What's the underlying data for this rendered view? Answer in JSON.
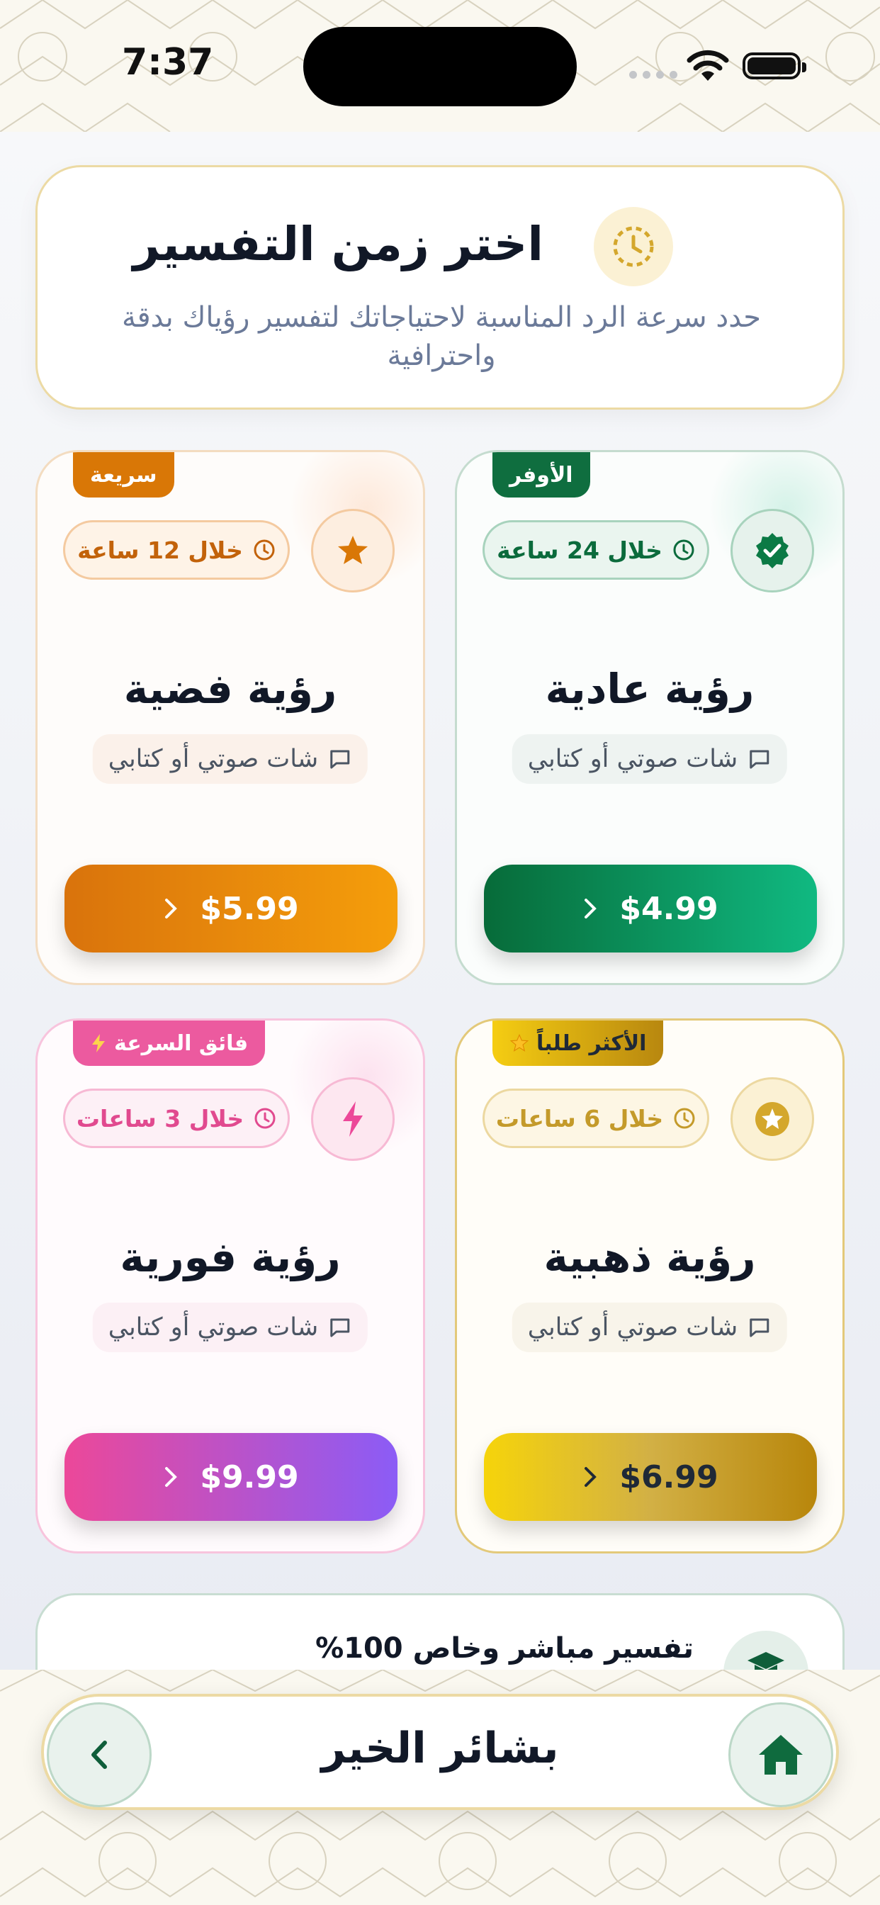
{
  "status_bar": {
    "time": "7:37"
  },
  "header": {
    "title": "اختر زمن التفسير",
    "subtitle": "حدد سرعة الرد المناسبة لاحتياجاتك لتفسير رؤياك بدقة واحترافية",
    "icon": "clock-icon"
  },
  "plans": [
    {
      "badge": "الأوفر",
      "time": "خلال 24 ساعة",
      "name": "رؤية عادية",
      "channel": "شات صوتي أو كتابي",
      "price": "$4.99",
      "icon": "verified-badge-icon",
      "accent": "#0b7a45"
    },
    {
      "badge": "سريعة",
      "time": "خلال 12 ساعة",
      "name": "رؤية فضية",
      "channel": "شات صوتي أو كتابي",
      "price": "$5.99",
      "icon": "star-icon",
      "accent": "#d97706"
    },
    {
      "badge": "الأكثر طلباً",
      "time": "خلال 6 ساعات",
      "name": "رؤية ذهبية",
      "channel": "شات صوتي أو كتابي",
      "price": "$6.99",
      "icon": "star-circle-icon",
      "accent": "#d4a72c"
    },
    {
      "badge": "فائق السرعة",
      "time": "خلال 3 ساعات",
      "name": "رؤية فورية",
      "channel": "شات صوتي أو كتابي",
      "price": "$9.99",
      "icon": "bolt-icon",
      "accent": "#ec4899"
    }
  ],
  "feature": {
    "text": "تفسير مباشر وخاص 100%",
    "icon": "graduation-cap-icon"
  },
  "nav": {
    "title": "بشائر الخير",
    "back_icon": "chevron-left-icon",
    "home_icon": "home-icon"
  }
}
